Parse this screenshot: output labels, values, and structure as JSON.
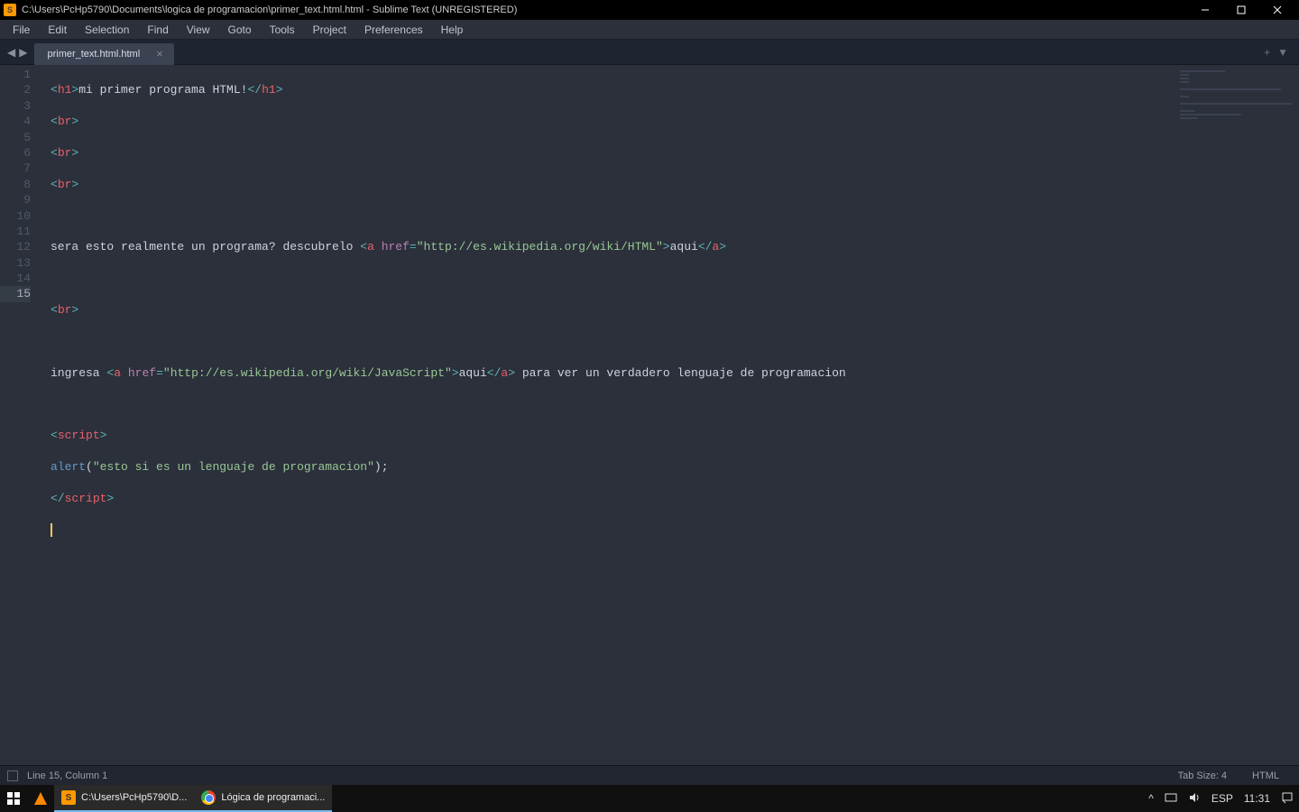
{
  "titlebar": {
    "title": "C:\\Users\\PcHp5790\\Documents\\logica de programacion\\primer_text.html.html - Sublime Text (UNREGISTERED)"
  },
  "menu": {
    "file": "File",
    "edit": "Edit",
    "selection": "Selection",
    "find": "Find",
    "view": "View",
    "goto": "Goto",
    "tools": "Tools",
    "project": "Project",
    "preferences": "Preferences",
    "help": "Help"
  },
  "tab": {
    "name": "primer_text.html.html"
  },
  "code": {
    "h1_text": "mi primer programa HTML!",
    "line6_text1": "sera esto realmente un programa? descubrelo ",
    "line6_url": "\"http://es.wikipedia.org/wiki/HTML\"",
    "line6_link": "aqui",
    "line10_text1": "ingresa ",
    "line10_url": "\"http://es.wikipedia.org/wiki/JavaScript\"",
    "line10_link": "aqui",
    "line10_text2": " para ver un verdadero lenguaje de programacion",
    "alert_str": "\"esto si es un lenguaje de programacion\"",
    "tag_h1": "h1",
    "tag_br": "br",
    "tag_a": "a",
    "tag_script": "script",
    "attr_href": "href",
    "fn_alert": "alert"
  },
  "lines": {
    "l1": "1",
    "l2": "2",
    "l3": "3",
    "l4": "4",
    "l5": "5",
    "l6": "6",
    "l7": "7",
    "l8": "8",
    "l9": "9",
    "l10": "10",
    "l11": "11",
    "l12": "12",
    "l13": "13",
    "l14": "14",
    "l15": "15"
  },
  "statusbar": {
    "position": "Line 15, Column 1",
    "tabsize": "Tab Size: 4",
    "syntax": "HTML"
  },
  "taskbar": {
    "item1": "C:\\Users\\PcHp5790\\D...",
    "item2": "Lógica de programaci...",
    "lang": "ESP",
    "time": "11:31"
  }
}
